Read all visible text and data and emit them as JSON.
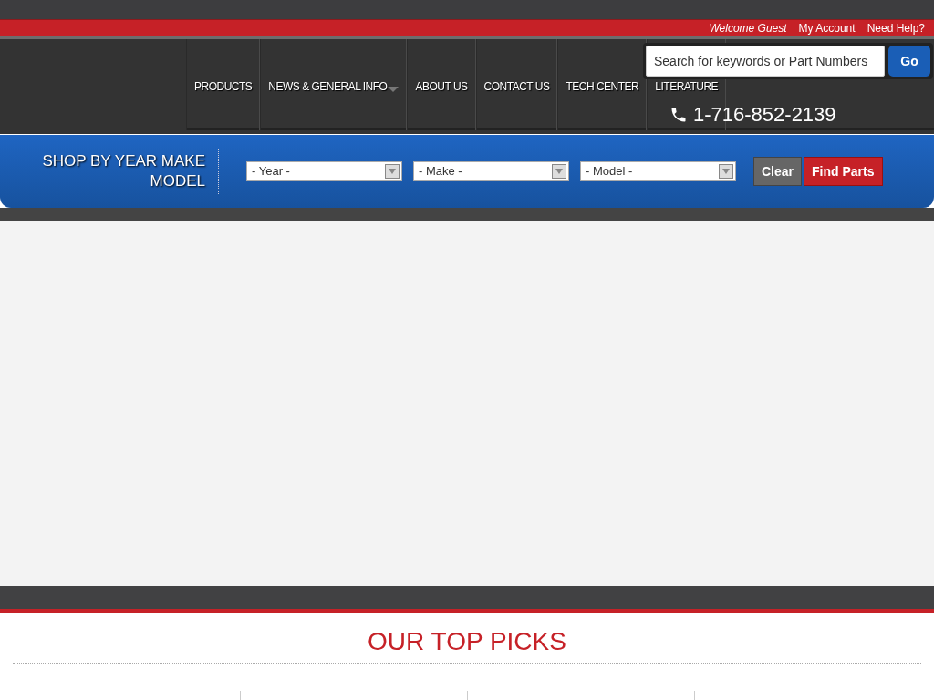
{
  "top_bar": {
    "welcome": "Welcome Guest",
    "links": [
      "My Account",
      "Need Help?"
    ]
  },
  "nav": {
    "items": [
      {
        "label": "PRODUCTS",
        "has_dropdown": false
      },
      {
        "label": "NEWS & GENERAL INFO",
        "has_dropdown": true
      },
      {
        "label": "ABOUT US",
        "has_dropdown": false
      },
      {
        "label": "CONTACT US",
        "has_dropdown": false
      },
      {
        "label": "TECH CENTER",
        "has_dropdown": false
      },
      {
        "label": "LITERATURE",
        "has_dropdown": false
      }
    ]
  },
  "search": {
    "placeholder": "Search for keywords or Part Numbers",
    "button": "Go"
  },
  "phone": "1-716-852-2139",
  "vehicle_finder": {
    "title": "SHOP BY YEAR MAKE MODEL",
    "selects": [
      "- Year -",
      "- Make -",
      "- Model -"
    ],
    "clear_button": "Clear",
    "find_button": "Find Parts"
  },
  "top_picks": {
    "title": "OUR TOP PICKS"
  }
}
